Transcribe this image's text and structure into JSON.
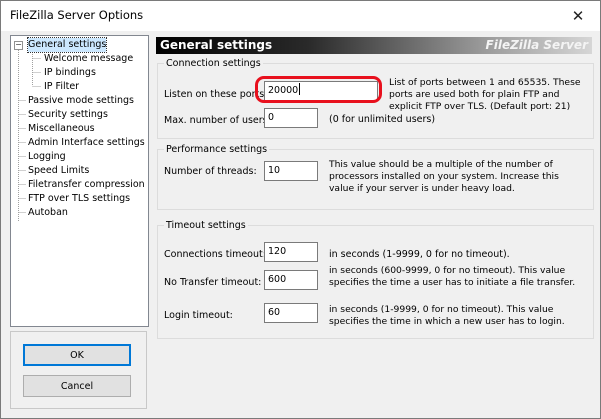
{
  "window": {
    "title": "FileZilla Server Options",
    "close_glyph": "✕"
  },
  "tree": {
    "items": [
      {
        "label": "General settings",
        "selected": true,
        "expandable": true
      },
      {
        "label": "Welcome message"
      },
      {
        "label": "IP bindings"
      },
      {
        "label": "IP Filter"
      },
      {
        "label": "Passive mode settings"
      },
      {
        "label": "Security settings"
      },
      {
        "label": "Miscellaneous"
      },
      {
        "label": "Admin Interface settings"
      },
      {
        "label": "Logging"
      },
      {
        "label": "Speed Limits"
      },
      {
        "label": "Filetransfer compression"
      },
      {
        "label": "FTP over TLS settings"
      },
      {
        "label": "Autoban"
      }
    ],
    "expander_glyph": "−"
  },
  "buttons": {
    "ok": "OK",
    "cancel": "Cancel"
  },
  "header": {
    "title": "General settings",
    "brand": "FileZilla Server"
  },
  "connection": {
    "legend": "Connection settings",
    "ports_label_pre": "Listen on these ports:",
    "ports_value": "20000",
    "ports_desc": "List of ports between 1 and 65535. These ports are used both for plain FTP and explicit FTP over TLS. (Default port: 21)",
    "max_users_label_pre": "Max. number of users:",
    "max_users_value": "0",
    "max_users_desc": "(0 for unlimited users)"
  },
  "performance": {
    "legend": "Performance settings",
    "threads_label": "Number of threads:",
    "threads_value": "10",
    "threads_desc": "This value should be a multiple of the number of processors installed on your system. Increase this value if your server is under heavy load."
  },
  "timeout": {
    "legend": "Timeout settings",
    "connections_label": "Connections timeout:",
    "connections_value": "120",
    "connections_desc": "in seconds (1-9999, 0 for no timeout).",
    "notransfer_label": "No Transfer timeout:",
    "notransfer_value": "600",
    "notransfer_desc": "in seconds (600-9999, 0 for no timeout). This value specifies the time a user has to initiate a file transfer.",
    "login_label": "Login timeout:",
    "login_value": "60",
    "login_desc": "in seconds (1-9999, 0 for no timeout). This value specifies the time in which a new user has to login."
  },
  "colors": {
    "highlight": "#e8101d",
    "selection": "#cce8ff",
    "default_button_border": "#0078d7"
  }
}
